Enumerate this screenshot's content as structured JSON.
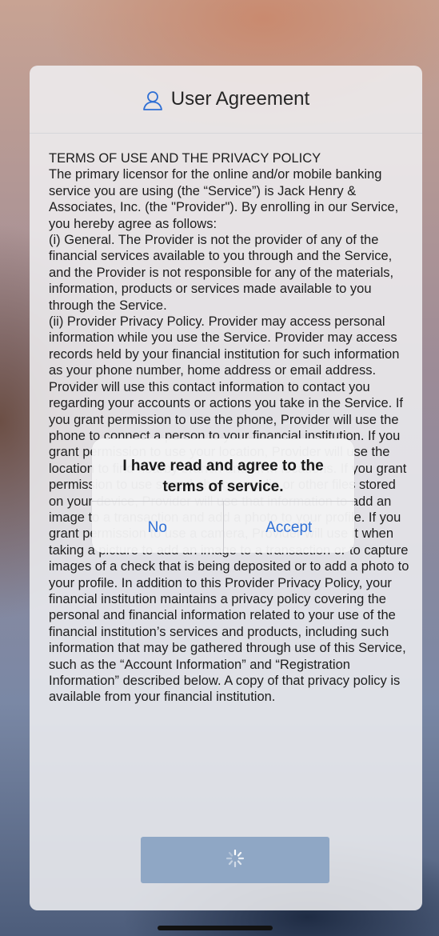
{
  "colors": {
    "accent": "#2f6fd4",
    "submit_button": "#8fa7c5",
    "card": "#f0f0f2"
  },
  "header": {
    "icon": "user-icon",
    "title": "User Agreement"
  },
  "terms": {
    "text": "TERMS OF USE AND THE PRIVACY POLICY\nThe primary licensor for the online and/or mobile banking service you are using (the “Service”) is Jack Henry & Associates, Inc. (the \"Provider\"). By enrolling in our Service, you hereby agree as follows:\n(i) General. The Provider is not the provider of any of the financial services available to you through and the Service, and the Provider is not responsible for any of the materials, information, products or services made available to you through the Service.\n(ii) Provider Privacy Policy. Provider may access personal information while you use the Service. Provider may access records held by your financial institution for such information as your phone number, home address or email address. Provider will use this contact information to contact you regarding your accounts or actions you take in the Service. If you grant permission to use the phone, Provider will use the phone to connect a person to your financial institution. If you grant permission to use your location, Provider will use the location to find nearby branch and ATM locations. If you grant permission to use stored photos, media or other files stored on your device, Provider will use that information to add an image to a transaction and add a photo to your profile. If you grant permission to use a camera, Provider will use it when taking a picture to add an image to a transaction or to capture images of a check that is being deposited or to add a photo to your profile. In addition to this Provider Privacy Policy, your financial institution maintains a privacy policy covering the personal and financial information related to your use of the financial institution’s services and products, including such information that may be gathered through use of this Service, such as the “Account Information” and “Registration Information” described below. A copy of that privacy policy is available from your financial institution."
  },
  "submit": {
    "icon": "loading-spinner-icon"
  },
  "alert": {
    "message": "I have read and agree to the terms of service.",
    "no_label": "No",
    "accept_label": "Accept"
  }
}
